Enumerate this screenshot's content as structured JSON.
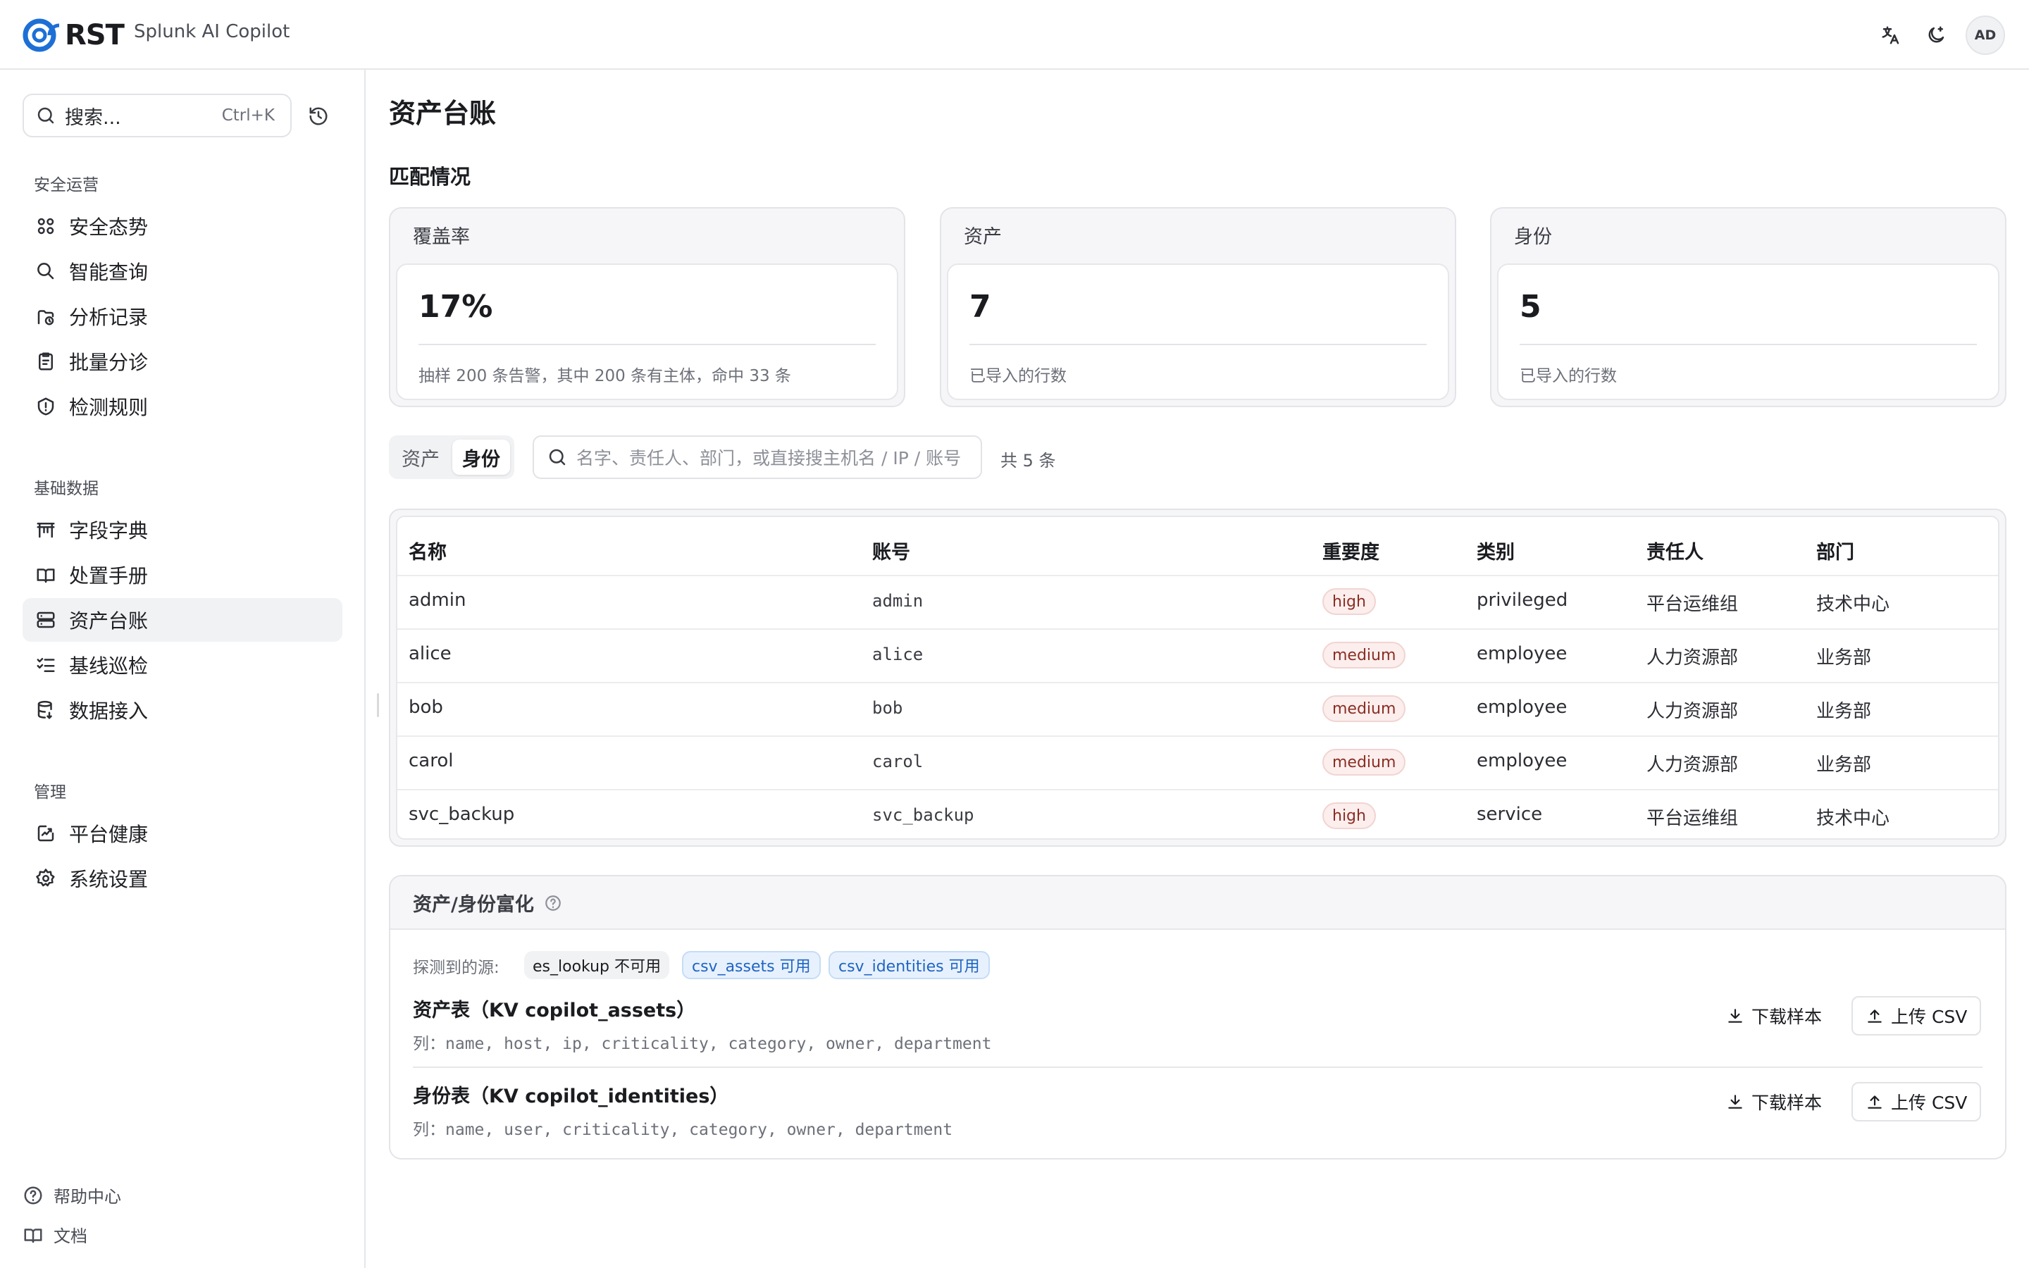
{
  "header": {
    "logo_text": "RST",
    "app_name": "Splunk AI Copilot",
    "avatar_initials": "AD",
    "icons": [
      "translate-icon",
      "theme-toggle-icon"
    ]
  },
  "sidebar": {
    "search_placeholder": "搜索...",
    "search_shortcut": "Ctrl+K",
    "sections": [
      {
        "title": "安全运营",
        "items": [
          {
            "label": "安全态势",
            "icon": "grid-icon"
          },
          {
            "label": "智能查询",
            "icon": "search-icon"
          },
          {
            "label": "分析记录",
            "icon": "history-folder-icon"
          },
          {
            "label": "批量分诊",
            "icon": "clipboard-icon"
          },
          {
            "label": "检测规则",
            "icon": "shield-alert-icon"
          }
        ]
      },
      {
        "title": "基础数据",
        "items": [
          {
            "label": "字段字典",
            "icon": "table-icon"
          },
          {
            "label": "处置手册",
            "icon": "book-icon"
          },
          {
            "label": "资产台账",
            "icon": "server-icon",
            "active": true
          },
          {
            "label": "基线巡检",
            "icon": "checklist-icon"
          },
          {
            "label": "数据接入",
            "icon": "database-icon"
          }
        ]
      },
      {
        "title": "管理",
        "items": [
          {
            "label": "平台健康",
            "icon": "activity-icon"
          },
          {
            "label": "系统设置",
            "icon": "gear-icon"
          }
        ]
      }
    ],
    "footer": [
      {
        "label": "帮助中心",
        "icon": "help-icon"
      },
      {
        "label": "文档",
        "icon": "book-open-icon"
      }
    ]
  },
  "main": {
    "title": "资产台账",
    "match_title": "匹配情况",
    "cards": [
      {
        "title": "覆盖率",
        "value": "17%",
        "desc": "抽样 200 条告警，其中 200 条有主体，命中 33 条"
      },
      {
        "title": "资产",
        "value": "7",
        "desc": "已导入的行数"
      },
      {
        "title": "身份",
        "value": "5",
        "desc": "已导入的行数"
      }
    ],
    "tabs": [
      "资产",
      "身份"
    ],
    "active_tab": "身份",
    "table_search_placeholder": "名字、责任人、部门，或直接搜主机名 / IP / 账号",
    "count_text": "共 5 条",
    "columns": [
      "名称",
      "账号",
      "重要度",
      "类别",
      "责任人",
      "部门"
    ],
    "rows": [
      {
        "name": "admin",
        "account": "admin",
        "criticality": "high",
        "category": "privileged",
        "owner": "平台运维组",
        "department": "技术中心"
      },
      {
        "name": "alice",
        "account": "alice",
        "criticality": "medium",
        "category": "employee",
        "owner": "人力资源部",
        "department": "业务部"
      },
      {
        "name": "bob",
        "account": "bob",
        "criticality": "medium",
        "category": "employee",
        "owner": "人力资源部",
        "department": "业务部"
      },
      {
        "name": "carol",
        "account": "carol",
        "criticality": "medium",
        "category": "employee",
        "owner": "人力资源部",
        "department": "业务部"
      },
      {
        "name": "svc_backup",
        "account": "svc_backup",
        "criticality": "high",
        "category": "service",
        "owner": "平台运维组",
        "department": "技术中心"
      }
    ],
    "enrichment": {
      "title": "资产/身份富化",
      "sources_label": "探测到的源:",
      "sources": [
        {
          "label": "es_lookup 不可用",
          "status": "unavailable"
        },
        {
          "label": "csv_assets 可用",
          "status": "available"
        },
        {
          "label": "csv_identities 可用",
          "status": "available"
        }
      ],
      "tables": [
        {
          "title": "资产表（KV copilot_assets）",
          "columns": "列：name, host, ip, criticality, category, owner, department",
          "download_label": "下载样本",
          "upload_label": "上传 CSV"
        },
        {
          "title": "身份表（KV copilot_identities）",
          "columns": "列：name, user, criticality, category, owner, department",
          "download_label": "下载样本",
          "upload_label": "上传 CSV"
        }
      ]
    }
  },
  "colors": {
    "accent_blue": "#1f64c2",
    "logo_blue": "#1d6fd6",
    "badge_red_text": "#8a2e24",
    "badge_red_bg": "#fbeeed"
  }
}
